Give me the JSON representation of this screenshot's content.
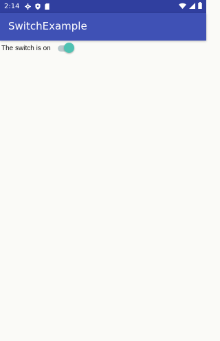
{
  "status_bar": {
    "time": "2:14",
    "left_icons": [
      "gear-icon",
      "shield-icon",
      "sd-card-icon"
    ],
    "right_icons": [
      "wifi-icon",
      "signal-icon",
      "battery-icon"
    ],
    "color": "#303f9f"
  },
  "app_bar": {
    "title": "SwitchExample",
    "color": "#3f51b5"
  },
  "main": {
    "switch_label": "The switch is on",
    "switch_state": "on",
    "switch_thumb_color": "#4fc2b2"
  }
}
